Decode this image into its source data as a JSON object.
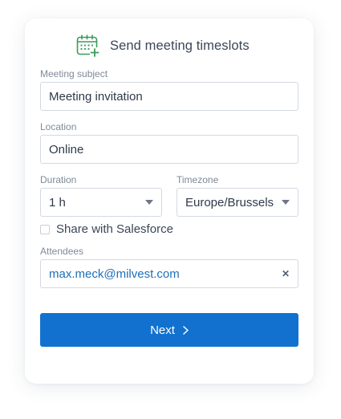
{
  "dialog": {
    "title": "Send meeting timeslots",
    "icon": "calendar-add-icon",
    "accent_color": "#1271cf",
    "icon_color": "#3a9c5a"
  },
  "form": {
    "subject": {
      "label": "Meeting subject",
      "value": "Meeting invitation"
    },
    "location": {
      "label": "Location",
      "value": "Online"
    },
    "duration": {
      "label": "Duration",
      "value": "1 h"
    },
    "timezone": {
      "label": "Timezone",
      "value": "Europe/Brussels"
    },
    "salesforce": {
      "label": "Share with Salesforce",
      "checked": false
    },
    "attendees": {
      "label": "Attendees",
      "value": "max.meck@milvest.com",
      "remove_symbol": "✕"
    }
  },
  "actions": {
    "next_label": "Next"
  }
}
